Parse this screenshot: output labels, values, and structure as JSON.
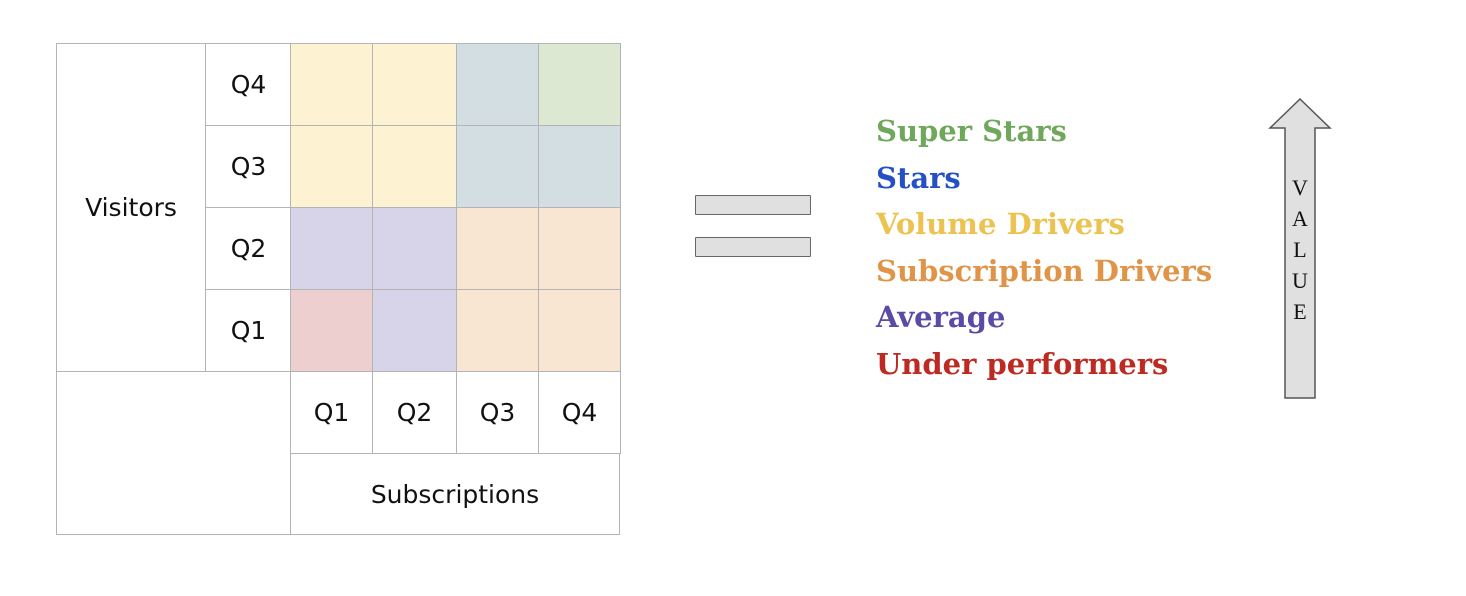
{
  "matrix": {
    "y_axis_label": "Visitors",
    "x_axis_label": "Subscriptions",
    "row_labels": [
      "Q4",
      "Q3",
      "Q2",
      "Q1"
    ],
    "col_labels": [
      "Q1",
      "Q2",
      "Q3",
      "Q4"
    ],
    "cells": [
      [
        "Volume Drivers",
        "Volume Drivers",
        "Stars",
        "Super Stars"
      ],
      [
        "Volume Drivers",
        "Volume Drivers",
        "Stars",
        "Stars"
      ],
      [
        "Average",
        "Average",
        "Subscription Drivers",
        "Subscription Drivers"
      ],
      [
        "Under performers",
        "Average",
        "Subscription Drivers",
        "Subscription Drivers"
      ]
    ]
  },
  "categories": [
    {
      "name": "Super Stars",
      "text_color": "#6fa85a",
      "fill": "#dde8d3"
    },
    {
      "name": "Stars",
      "text_color": "#2450c4",
      "fill": "#d2dee2"
    },
    {
      "name": "Volume Drivers",
      "text_color": "#ecc350",
      "fill": "#fdf2d1"
    },
    {
      "name": "Subscription Drivers",
      "text_color": "#df9448",
      "fill": "#f9e6d2"
    },
    {
      "name": "Average",
      "text_color": "#5b4aa6",
      "fill": "#d7d3e8"
    },
    {
      "name": "Under performers",
      "text_color": "#bd2a22",
      "fill": "#eecfcf"
    }
  ],
  "equals_sign": "=",
  "value_arrow": {
    "label": "VALUE",
    "letters": [
      "V",
      "A",
      "L",
      "U",
      "E"
    ]
  }
}
